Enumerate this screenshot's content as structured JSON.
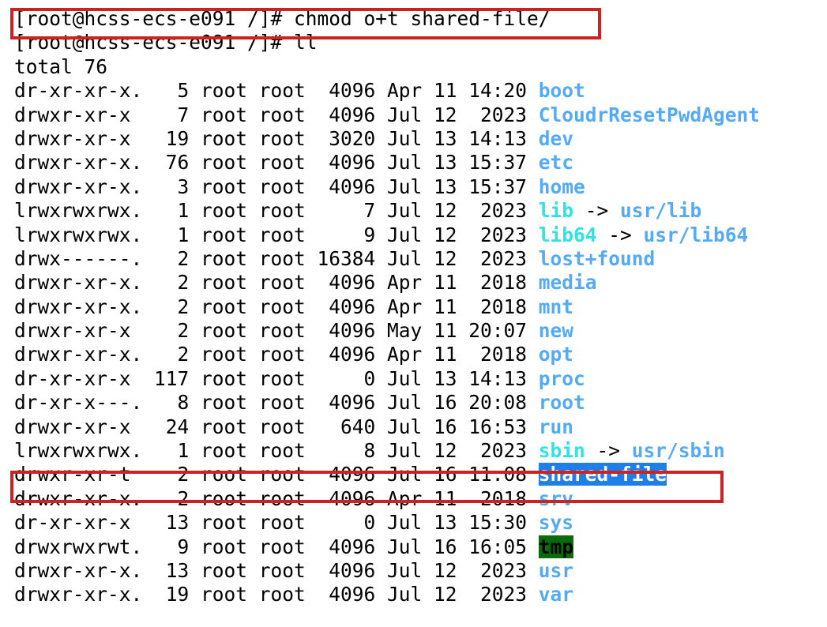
{
  "terminal": {
    "prompt": "[root@hcss-ecs-e091 /]# ",
    "command_line_1": "[root@hcss-ecs-e091 /]# chmod o+t shared-file/",
    "command_line_2": "[root@hcss-ecs-e091 /]# ll",
    "total_line": "total 76",
    "colors": {
      "background": "#ffffff",
      "foreground": "#000000",
      "directory": "#55aaf5",
      "symlink": "#2fe3e3",
      "symlink_target": "#55aaf5",
      "sticky_dir_bg": "#1f7fe8",
      "sticky_dir_fg": "#ffffff",
      "sticky_other_write_bg": "#0a6b0a",
      "sticky_other_write_fg": "#000000",
      "annotation_red": "#cc2222"
    }
  },
  "listing": {
    "columns": [
      "permissions",
      "links",
      "owner",
      "group",
      "size",
      "month",
      "day",
      "time",
      "name"
    ],
    "rows": [
      {
        "permissions": "dr-xr-xr-x.",
        "links": "5",
        "owner": "root",
        "group": "root",
        "size": "4096",
        "month": "Apr",
        "day": "11",
        "time": "14:20",
        "name": "boot",
        "type": "dir",
        "arrow": "",
        "target": ""
      },
      {
        "permissions": "drwxr-xr-x",
        "links": "7",
        "owner": "root",
        "group": "root",
        "size": "4096",
        "month": "Jul",
        "day": "12",
        "time": "2023",
        "name": "CloudrResetPwdAgent",
        "type": "dir",
        "arrow": "",
        "target": ""
      },
      {
        "permissions": "drwxr-xr-x",
        "links": "19",
        "owner": "root",
        "group": "root",
        "size": "3020",
        "month": "Jul",
        "day": "13",
        "time": "14:13",
        "name": "dev",
        "type": "dir",
        "arrow": "",
        "target": ""
      },
      {
        "permissions": "drwxr-xr-x.",
        "links": "76",
        "owner": "root",
        "group": "root",
        "size": "4096",
        "month": "Jul",
        "day": "13",
        "time": "15:37",
        "name": "etc",
        "type": "dir",
        "arrow": "",
        "target": ""
      },
      {
        "permissions": "drwxr-xr-x.",
        "links": "3",
        "owner": "root",
        "group": "root",
        "size": "4096",
        "month": "Jul",
        "day": "13",
        "time": "15:37",
        "name": "home",
        "type": "dir",
        "arrow": "",
        "target": ""
      },
      {
        "permissions": "lrwxrwxrwx.",
        "links": "1",
        "owner": "root",
        "group": "root",
        "size": "7",
        "month": "Jul",
        "day": "12",
        "time": "2023",
        "name": "lib",
        "type": "link",
        "arrow": " -> ",
        "target": "usr/lib"
      },
      {
        "permissions": "lrwxrwxrwx.",
        "links": "1",
        "owner": "root",
        "group": "root",
        "size": "9",
        "month": "Jul",
        "day": "12",
        "time": "2023",
        "name": "lib64",
        "type": "link",
        "arrow": " -> ",
        "target": "usr/lib64"
      },
      {
        "permissions": "drwx------.",
        "links": "2",
        "owner": "root",
        "group": "root",
        "size": "16384",
        "month": "Jul",
        "day": "12",
        "time": "2023",
        "name": "lost+found",
        "type": "dir",
        "arrow": "",
        "target": ""
      },
      {
        "permissions": "drwxr-xr-x.",
        "links": "2",
        "owner": "root",
        "group": "root",
        "size": "4096",
        "month": "Apr",
        "day": "11",
        "time": "2018",
        "name": "media",
        "type": "dir",
        "arrow": "",
        "target": ""
      },
      {
        "permissions": "drwxr-xr-x.",
        "links": "2",
        "owner": "root",
        "group": "root",
        "size": "4096",
        "month": "Apr",
        "day": "11",
        "time": "2018",
        "name": "mnt",
        "type": "dir",
        "arrow": "",
        "target": ""
      },
      {
        "permissions": "drwxr-xr-x",
        "links": "2",
        "owner": "root",
        "group": "root",
        "size": "4096",
        "month": "May",
        "day": "11",
        "time": "20:07",
        "name": "new",
        "type": "dir",
        "arrow": "",
        "target": ""
      },
      {
        "permissions": "drwxr-xr-x.",
        "links": "2",
        "owner": "root",
        "group": "root",
        "size": "4096",
        "month": "Apr",
        "day": "11",
        "time": "2018",
        "name": "opt",
        "type": "dir",
        "arrow": "",
        "target": ""
      },
      {
        "permissions": "dr-xr-xr-x",
        "links": "117",
        "owner": "root",
        "group": "root",
        "size": "0",
        "month": "Jul",
        "day": "13",
        "time": "14:13",
        "name": "proc",
        "type": "dir",
        "arrow": "",
        "target": ""
      },
      {
        "permissions": "dr-xr-x---.",
        "links": "8",
        "owner": "root",
        "group": "root",
        "size": "4096",
        "month": "Jul",
        "day": "16",
        "time": "20:08",
        "name": "root",
        "type": "dir",
        "arrow": "",
        "target": ""
      },
      {
        "permissions": "drwxr-xr-x",
        "links": "24",
        "owner": "root",
        "group": "root",
        "size": "640",
        "month": "Jul",
        "day": "16",
        "time": "16:53",
        "name": "run",
        "type": "dir",
        "arrow": "",
        "target": ""
      },
      {
        "permissions": "lrwxrwxrwx.",
        "links": "1",
        "owner": "root",
        "group": "root",
        "size": "8",
        "month": "Jul",
        "day": "12",
        "time": "2023",
        "name": "sbin",
        "type": "link",
        "arrow": " -> ",
        "target": "usr/sbin"
      },
      {
        "permissions": "drwxr-xr-t",
        "links": "2",
        "owner": "root",
        "group": "root",
        "size": "4096",
        "month": "Jul",
        "day": "16",
        "time": "11:08",
        "name": "shared-file",
        "type": "sticky",
        "arrow": "",
        "target": ""
      },
      {
        "permissions": "drwxr-xr-x.",
        "links": "2",
        "owner": "root",
        "group": "root",
        "size": "4096",
        "month": "Apr",
        "day": "11",
        "time": "2018",
        "name": "srv",
        "type": "dir",
        "arrow": "",
        "target": ""
      },
      {
        "permissions": "dr-xr-xr-x",
        "links": "13",
        "owner": "root",
        "group": "root",
        "size": "0",
        "month": "Jul",
        "day": "13",
        "time": "15:30",
        "name": "sys",
        "type": "dir",
        "arrow": "",
        "target": ""
      },
      {
        "permissions": "drwxrwxrwt.",
        "links": "9",
        "owner": "root",
        "group": "root",
        "size": "4096",
        "month": "Jul",
        "day": "16",
        "time": "16:05",
        "name": "tmp",
        "type": "tmp",
        "arrow": "",
        "target": ""
      },
      {
        "permissions": "drwxr-xr-x.",
        "links": "13",
        "owner": "root",
        "group": "root",
        "size": "4096",
        "month": "Jul",
        "day": "12",
        "time": "2023",
        "name": "usr",
        "type": "dir",
        "arrow": "",
        "target": ""
      },
      {
        "permissions": "drwxr-xr-x.",
        "links": "19",
        "owner": "root",
        "group": "root",
        "size": "4096",
        "month": "Jul",
        "day": "12",
        "time": "2023",
        "name": "var",
        "type": "dir",
        "arrow": "",
        "target": ""
      }
    ]
  },
  "annotations": [
    {
      "id": "annot-cmd",
      "label": "chmod-command-highlight"
    },
    {
      "id": "annot-row",
      "label": "shared-file-row-highlight"
    }
  ]
}
